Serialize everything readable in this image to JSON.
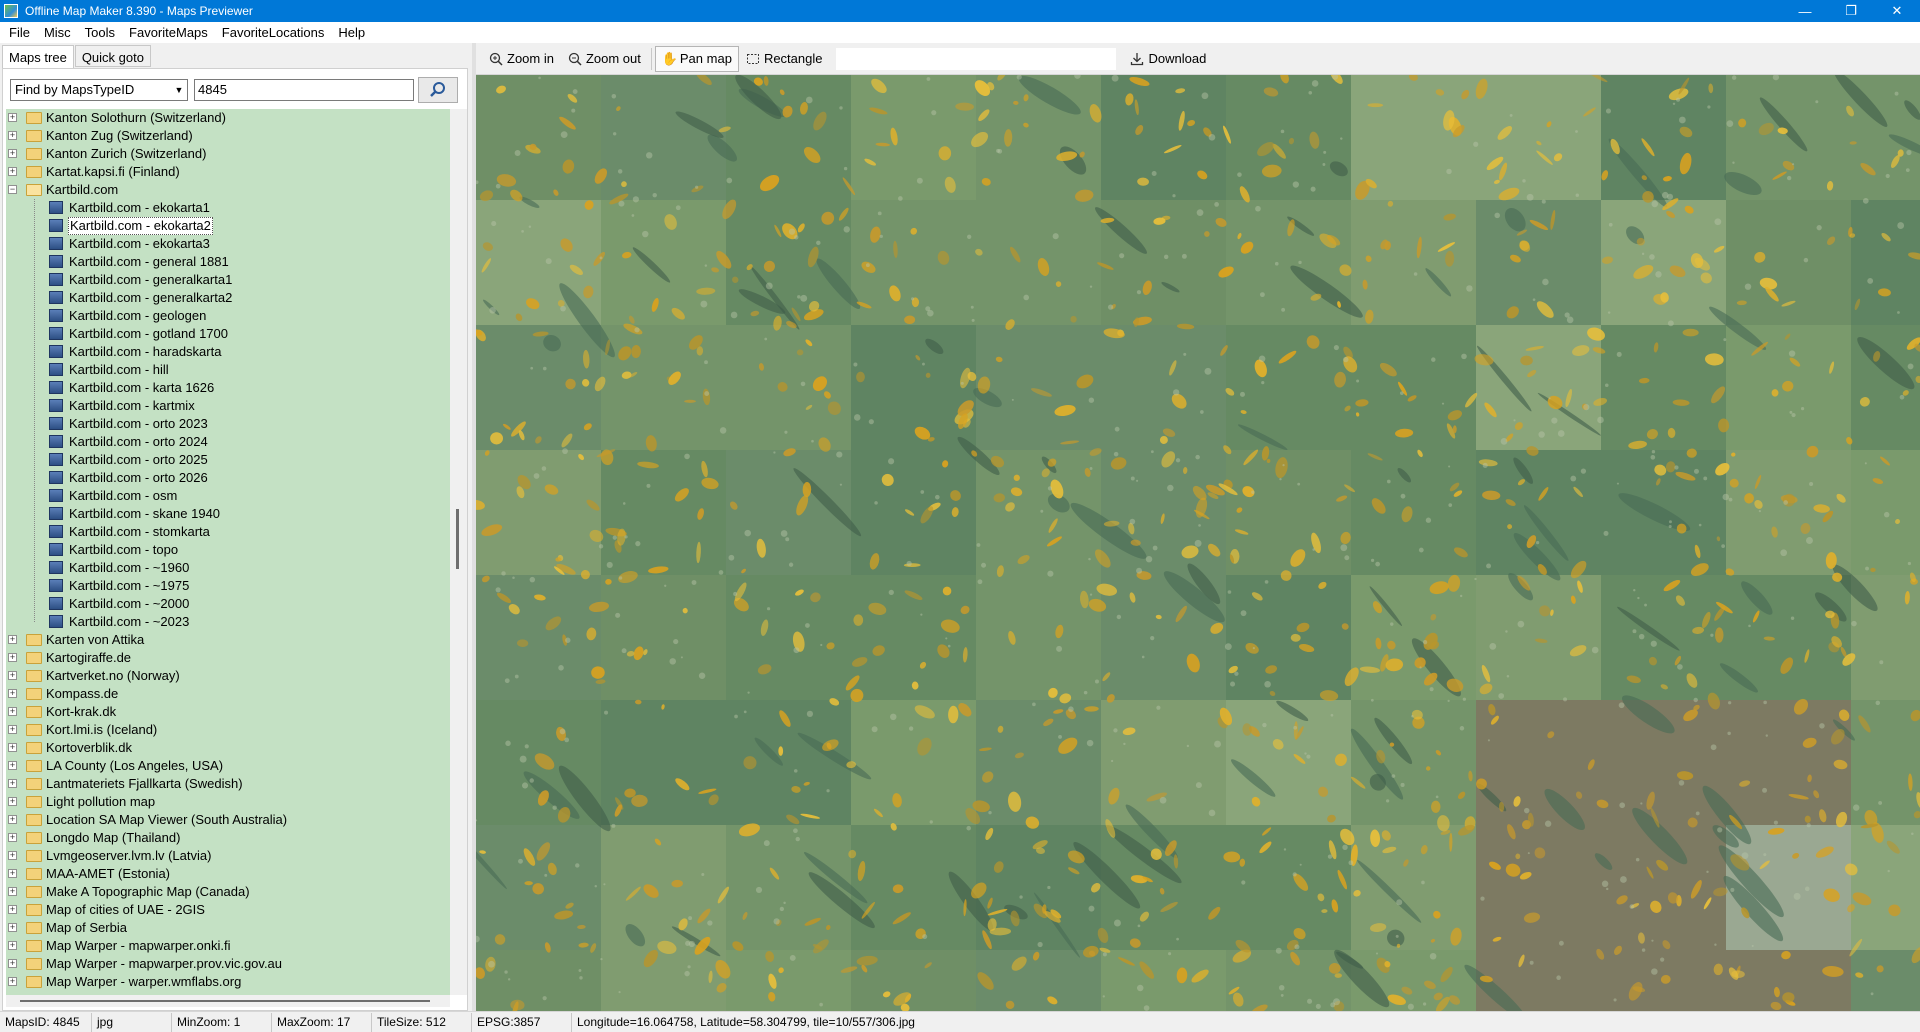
{
  "window": {
    "title": "Offline Map Maker 8.390 - Maps Previewer",
    "minimize": "—",
    "maximize": "❐",
    "close": "✕"
  },
  "menu": [
    "File",
    "Misc",
    "Tools",
    "FavoriteMaps",
    "FavoriteLocations",
    "Help"
  ],
  "left_panel": {
    "tabs": [
      "Maps tree",
      "Quick goto"
    ],
    "active_tab": "Maps tree",
    "find_mode": "Find by MapsTypeID",
    "search_value": "4845"
  },
  "tree": {
    "folders_before": [
      "Kanton Solothurn (Switzerland)",
      "Kanton Zug (Switzerland)",
      "Kanton Zurich (Switzerland)",
      "Kartat.kapsi.fi (Finland)"
    ],
    "expanded_folder": "Kartbild.com",
    "children": [
      "Kartbild.com - ekokarta1",
      "Kartbild.com - ekokarta2",
      "Kartbild.com - ekokarta3",
      "Kartbild.com - general 1881",
      "Kartbild.com - generalkarta1",
      "Kartbild.com - generalkarta2",
      "Kartbild.com - geologen",
      "Kartbild.com - gotland 1700",
      "Kartbild.com - haradskarta",
      "Kartbild.com - hill",
      "Kartbild.com - karta 1626",
      "Kartbild.com - kartmix",
      "Kartbild.com - orto 2023",
      "Kartbild.com - orto 2024",
      "Kartbild.com - orto 2025",
      "Kartbild.com - orto 2026",
      "Kartbild.com - osm",
      "Kartbild.com - skane 1940",
      "Kartbild.com - stomkarta",
      "Kartbild.com - topo",
      "Kartbild.com - ~1960",
      "Kartbild.com - ~1975",
      "Kartbild.com - ~2000",
      "Kartbild.com - ~2023"
    ],
    "selected_child": "Kartbild.com - ekokarta2",
    "folders_after": [
      "Karten von Attika",
      "Kartogiraffe.de",
      "Kartverket.no (Norway)",
      "Kompass.de",
      "Kort-krak.dk",
      "Kort.lmi.is (Iceland)",
      "Kortoverblik.dk",
      "LA County (Los Angeles, USA)",
      "Lantmateriets Fjallkarta (Swedish)",
      "Light pollution map",
      "Location SA Map Viewer (South Australia)",
      "Longdo Map (Thailand)",
      "Lvmgeoserver.lvm.lv (Latvia)",
      "MAA-AMET (Estonia)",
      "Make A Topographic Map (Canada)",
      "Map of cities of UAE - 2GIS",
      "Map of Serbia",
      "Map Warper - mapwarper.onki.fi",
      "Map Warper - mapwarper.prov.vic.gov.au",
      "Map Warper - warper.wmflabs.org"
    ]
  },
  "toolbar": {
    "zoom_in": "Zoom in",
    "zoom_out": "Zoom out",
    "pan_map": "Pan map",
    "rectangle": "Rectangle",
    "download": "Download",
    "active_tool": "Pan map"
  },
  "status": {
    "maps_id": "MapsID: 4845",
    "format": "jpg",
    "min_zoom": "MinZoom: 1",
    "max_zoom": "MaxZoom: 17",
    "tile_size": "TileSize: 512",
    "epsg": "EPSG:3857",
    "coords": "Longitude=16.064758, Latitude=58.304799, tile=10/557/306.jpg"
  },
  "colors": {
    "titlebar": "#0078d7",
    "tree_background": "#c4e1c4",
    "map_base": "#6a8a62"
  }
}
